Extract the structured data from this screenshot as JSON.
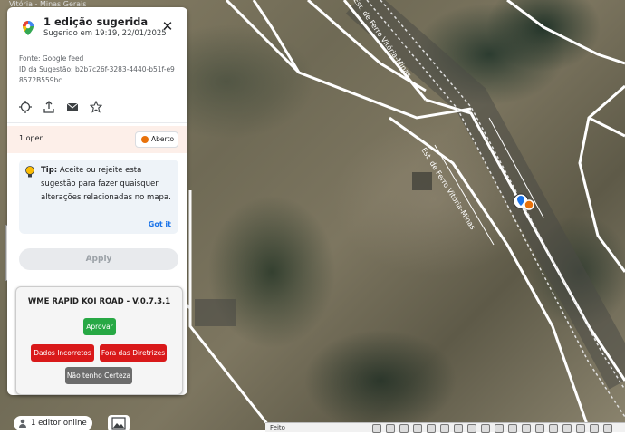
{
  "map": {
    "road_label_1": "Est. de Ferro Vitória-Minas",
    "road_label_2": "Est. de Ferro Vitória-Minas",
    "top_label": "Vitória - Minas Gerais"
  },
  "panel": {
    "title": "1 edição sugerida",
    "subtitle": "Sugerido em 19:19, 22/01/2025",
    "source": "Fonte: Google feed",
    "suggestion_id": "ID da Sugestão: b2b7c26f-3283-4440-b51f-e98572B559bc",
    "open_count": "1 open",
    "status": "Aberto",
    "tip_label": "Tip:",
    "tip_text": "Aceite ou rejeite esta sugestão para fazer quaisquer alterações relacionadas no mapa.",
    "gotit": "Got it",
    "apply": "Apply"
  },
  "koi": {
    "title": "WME RAPID KOI ROAD - V.0.7.3.1",
    "approve": "Aprovar",
    "wrong_data": "Dados Incorretos",
    "out_of_guidelines": "Fora das Diretrizes",
    "not_sure": "Não tenho Certeza"
  },
  "footer": {
    "editors": "1 editor online",
    "toolbar_label": "Feito"
  },
  "colors": {
    "accent": "#1a73e8",
    "status_orange": "#e8710a",
    "approve_green": "#27a844",
    "reject_red": "#d9191a",
    "neutral_gray": "#6c6c6c"
  },
  "icons": [
    "google-maps-pin-icon",
    "close-icon",
    "crosshair-icon",
    "share-icon",
    "mail-icon",
    "star-icon",
    "lightbulb-icon",
    "image-icon",
    "user-icon"
  ]
}
